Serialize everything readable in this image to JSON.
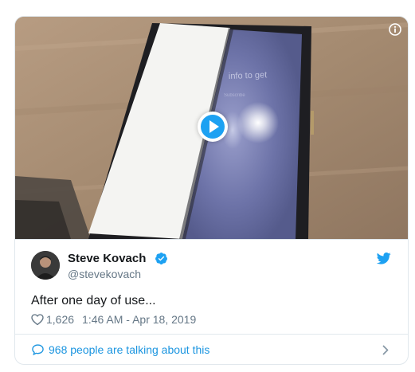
{
  "media": {
    "screen_text_1": "info to get",
    "screen_text_2": "Subscribe"
  },
  "author": {
    "display_name": "Steve Kovach",
    "handle": "@stevekovach",
    "verified": true
  },
  "tweet": {
    "text": "After one day of use...",
    "likes": "1,626",
    "timestamp": "1:46 AM - Apr 18, 2019"
  },
  "footer": {
    "talking_text": "968 people are talking about this"
  },
  "colors": {
    "accent": "#1da1f2",
    "link": "#1b95e0",
    "text": "#14171a",
    "muted": "#657786",
    "border": "#e1e8ed"
  },
  "icons": {
    "info": "info-icon",
    "play": "play-icon",
    "verified": "verified-badge-icon",
    "brand": "twitter-bird-icon",
    "like": "heart-icon",
    "conversation": "chat-bubble-icon",
    "more": "chevron-right-icon"
  }
}
